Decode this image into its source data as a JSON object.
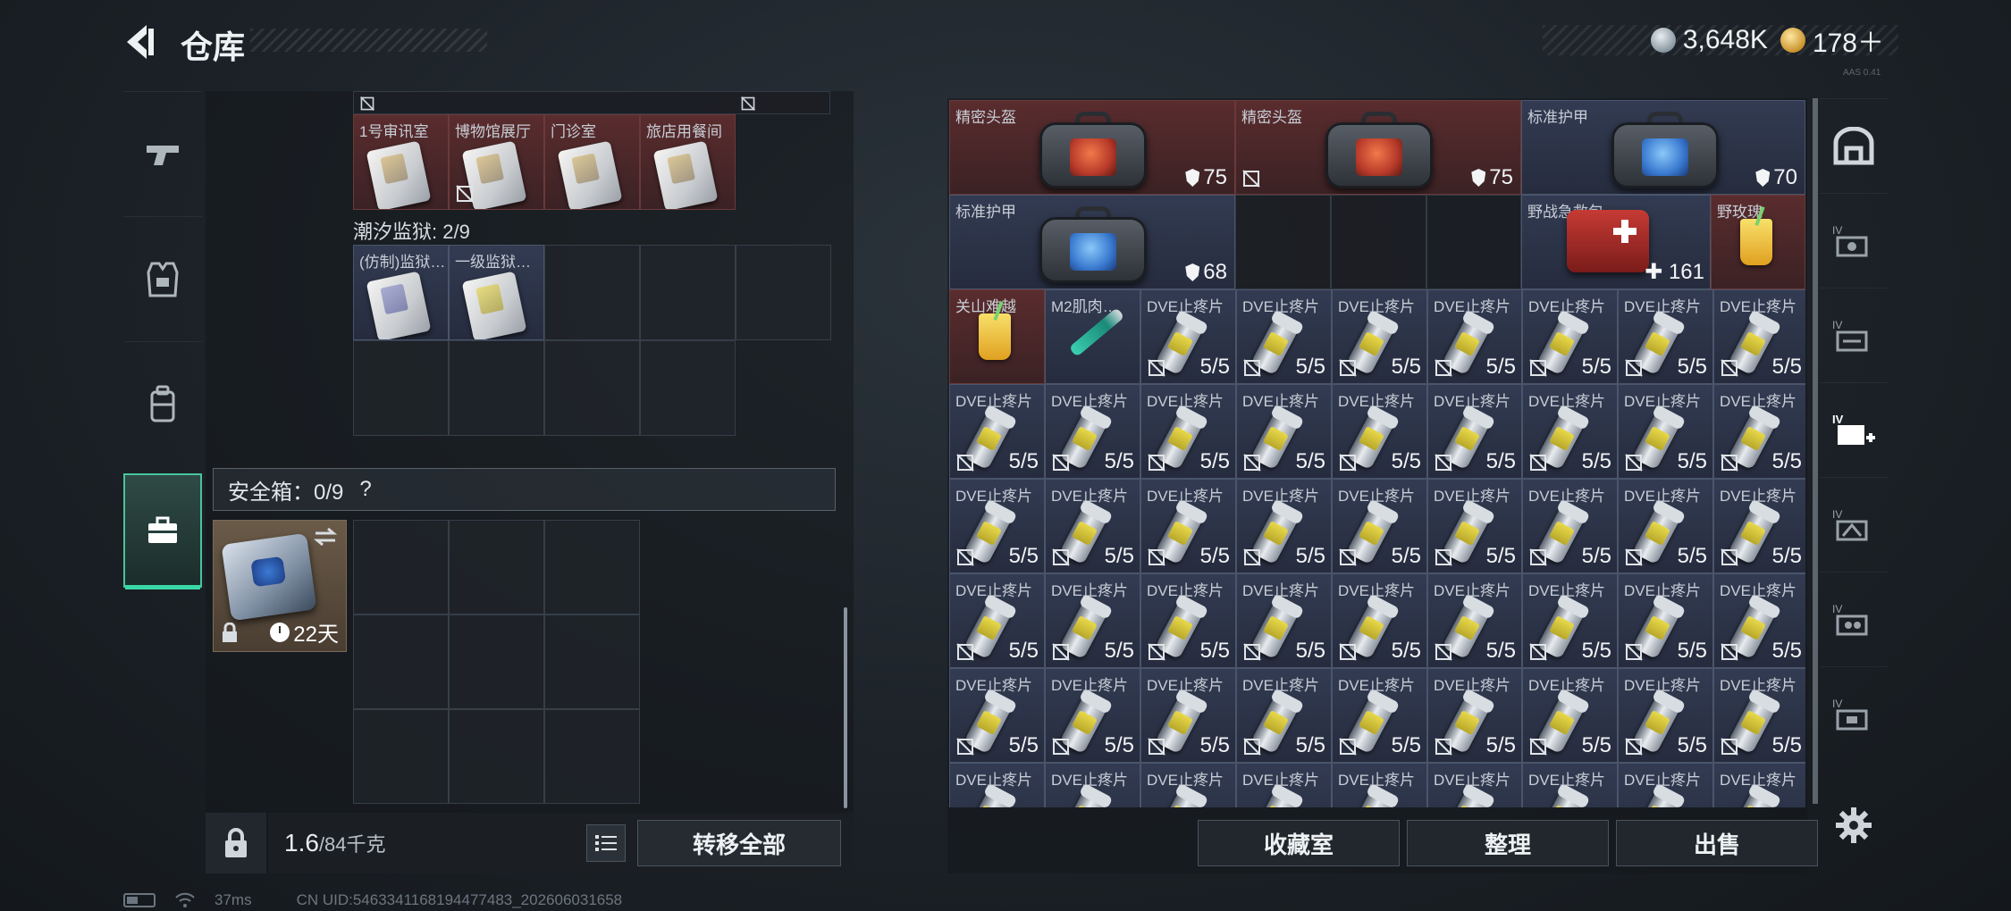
{
  "header": {
    "title": "仓库",
    "currency_silver": "3,648K",
    "currency_gold": "178＋",
    "version_tag": "AAS 0.41"
  },
  "left_nav": [
    "weapon",
    "armor",
    "backpack",
    "case"
  ],
  "keycards_top": [
    {
      "label": "1号审讯室",
      "no_carry": false
    },
    {
      "label": "博物馆展厅",
      "no_carry": true
    },
    {
      "label": "门诊室",
      "no_carry": false
    },
    {
      "label": "旅店用餐间",
      "no_carry": false
    }
  ],
  "section": {
    "name": "潮汐监狱: 2/9",
    "items": [
      {
        "label": "(仿制)监狱…",
        "variant": "alt"
      },
      {
        "label": "一级监狱…",
        "variant": "yel"
      }
    ]
  },
  "safe": {
    "label": "安全箱：0/9",
    "help": "?",
    "days": "22天"
  },
  "weight": {
    "current": "1.6",
    "max": "/84千克"
  },
  "buttons": {
    "transfer_all": "转移全部",
    "collection": "收藏室",
    "organize": "整理",
    "sell": "出售"
  },
  "stash": {
    "row1": [
      {
        "label": "精密头盔",
        "value": "75",
        "tone": "red",
        "screen": "red",
        "no_carry": false
      },
      {
        "label": "精密头盔",
        "value": "75",
        "tone": "red",
        "screen": "red",
        "no_carry": true
      },
      {
        "label": "标准护甲",
        "value": "70",
        "tone": "blue",
        "screen": "blue",
        "no_carry": false
      }
    ],
    "row2": {
      "armor": {
        "label": "标准护甲",
        "value": "68"
      },
      "medkit": {
        "label": "野战急救包",
        "value": "161"
      },
      "drink": {
        "label": "野玫瑰"
      }
    },
    "row3_special": [
      {
        "label": "关山难越"
      },
      {
        "label": "M2肌肉…"
      }
    ],
    "pill_label": "DVE止疼片",
    "pill_count": "5/5"
  },
  "status_bar": {
    "ping": "37ms",
    "uid": "CN UID:5463341168194477483_202606031658"
  }
}
